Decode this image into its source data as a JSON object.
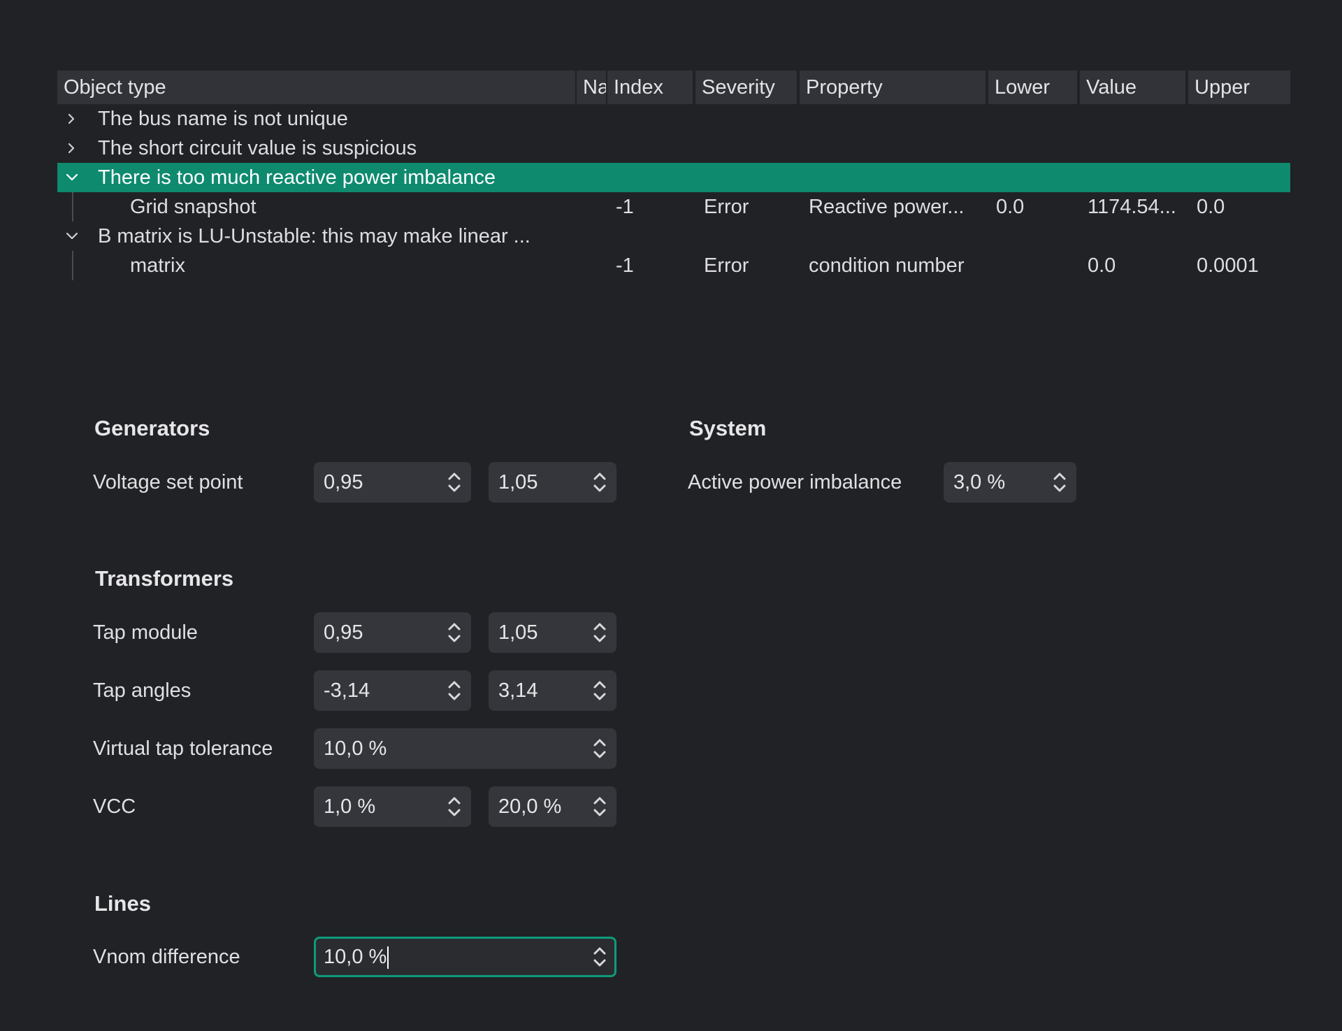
{
  "table": {
    "columns": [
      "Object type",
      "Na",
      "Index",
      "Severity",
      "Property",
      "Lower",
      "Value",
      "Upper"
    ],
    "rows": [
      {
        "kind": "group",
        "expanded": false,
        "text": "The bus name is not unique"
      },
      {
        "kind": "group",
        "expanded": false,
        "text": "The short circuit value is suspicious"
      },
      {
        "kind": "group",
        "expanded": true,
        "selected": true,
        "text": "There is too much reactive power imbalance"
      },
      {
        "kind": "child",
        "object_type": "Grid snapshot",
        "index": "-1",
        "severity": "Error",
        "property": "Reactive power...",
        "lower": "0.0",
        "value": "1174.54...",
        "upper": "0.0"
      },
      {
        "kind": "group",
        "expanded": true,
        "text": "B matrix is LU-Unstable: this may make linear ..."
      },
      {
        "kind": "child",
        "object_type": "matrix",
        "index": "-1",
        "severity": "Error",
        "property": "condition number",
        "lower": "",
        "value": "0.0",
        "upper": "0.0001"
      }
    ]
  },
  "generators": {
    "title": "Generators",
    "voltage_set_point": {
      "label": "Voltage set point",
      "min": "0,95",
      "max": "1,05"
    }
  },
  "system": {
    "title": "System",
    "active_power_imbalance": {
      "label": "Active power imbalance",
      "value": "3,0 %"
    }
  },
  "transformers": {
    "title": "Transformers",
    "tap_module": {
      "label": "Tap module",
      "min": "0,95",
      "max": "1,05"
    },
    "tap_angles": {
      "label": "Tap angles",
      "min": "-3,14",
      "max": "3,14"
    },
    "virtual_tap_tolerance": {
      "label": "Virtual tap tolerance",
      "value": "10,0 %"
    },
    "vcc": {
      "label": "VCC",
      "min": "1,0 %",
      "max": "20,0 %"
    }
  },
  "lines": {
    "title": "Lines",
    "vnom_difference": {
      "label": "Vnom difference",
      "value": "10,0 %"
    }
  },
  "colors": {
    "background": "#212226",
    "header": "#323338",
    "selection": "#0e8a6f",
    "input": "#35363b",
    "focus": "#0e9b7a"
  },
  "icons": {
    "expanded": "chevron-down-icon",
    "collapsed": "chevron-right-icon",
    "spinner": "stepper-arrows-icon"
  }
}
